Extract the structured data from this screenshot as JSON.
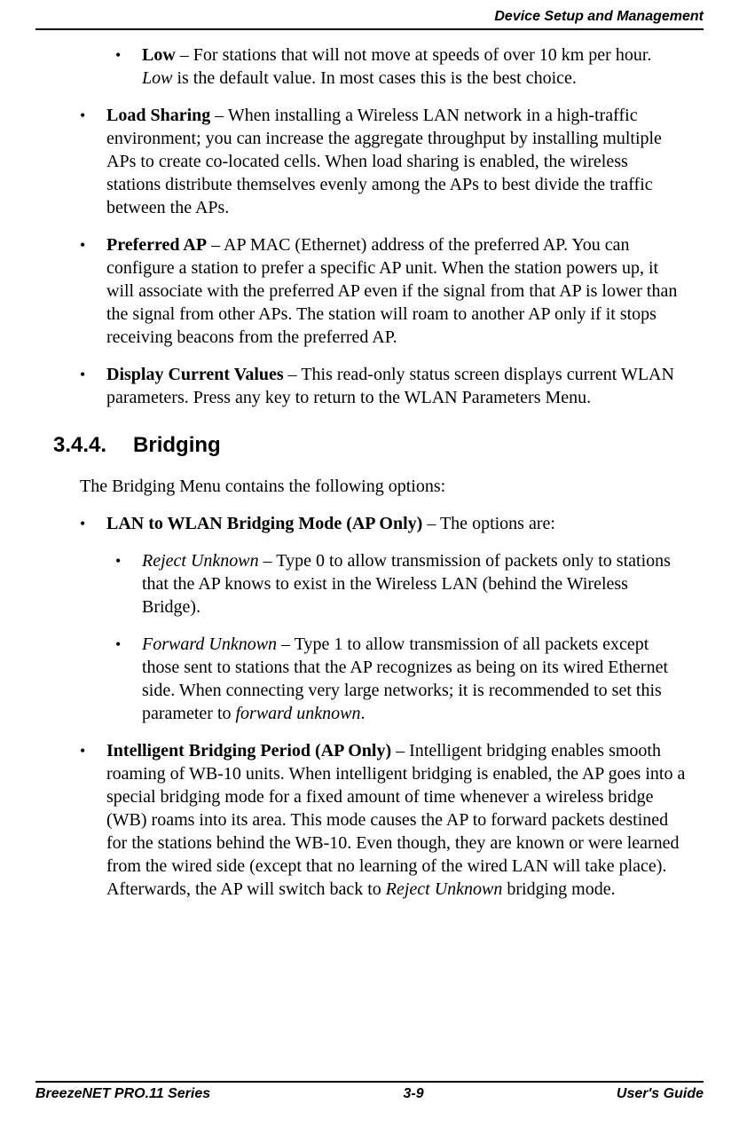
{
  "header": {
    "section_title": "Device Setup and Management"
  },
  "content": {
    "low": {
      "term": "Low",
      "sep": "  – ",
      "text1": "For stations that will not move at speeds of over 10 km per hour. ",
      "italic": "Low",
      "text2": " is the default value. In most cases this is the best choice."
    },
    "load_sharing": {
      "term": "Load Sharing",
      "sep": " – ",
      "text": "When installing a Wireless LAN network in a high-traffic environment; you can increase the aggregate throughput by installing multiple APs to create co-located cells. When load sharing is enabled, the wireless stations distribute themselves evenly among the APs to best divide the traffic between the APs."
    },
    "preferred_ap": {
      "term": "Preferred AP",
      "sep": " – ",
      "text": "AP MAC (Ethernet) address of the preferred AP. You can configure a station to prefer a specific AP unit. When the station powers up, it will associate with the preferred AP even if the signal from that AP is lower than the signal from other APs. The station will roam to another AP only if it stops receiving beacons from the preferred AP."
    },
    "display_current": {
      "term": "Display Current Values",
      "sep": " – ",
      "text": "This read-only status screen displays current WLAN parameters. Press any key to return to the WLAN Parameters Menu."
    },
    "heading": {
      "number": "3.4.4.",
      "title": "Bridging"
    },
    "intro": "The Bridging Menu contains the following options:",
    "lan_wlan": {
      "term": "LAN to WLAN Bridging Mode (AP Only)",
      "sep": " – ",
      "text": "The options are:"
    },
    "reject_unknown": {
      "term": "Reject Unknown",
      "sep": " – ",
      "text": "Type 0 to allow transmission of packets only to stations that the AP knows to exist in the Wireless LAN (behind the Wireless Bridge)."
    },
    "forward_unknown": {
      "term": "Forward Unknown",
      "sep": " – ",
      "text1": "Type 1 to allow transmission of all packets except those sent to stations that the AP recognizes as being on its wired Ethernet side. When connecting very large networks; it is recommended to set this parameter to ",
      "italic": "forward unknown",
      "text2": "."
    },
    "intelligent_bridging": {
      "term": "Intelligent Bridging Period (AP Only)",
      "sep": " – ",
      "text1": "Intelligent bridging enables smooth roaming of WB-10 units. When intelligent bridging is enabled, the AP goes into a special bridging mode for a fixed amount of time whenever a wireless bridge (WB) roams into its area. This mode causes the AP to forward packets destined for the stations behind the WB-10. Even though, they are known or were learned from the wired side (except that no learning of the wired LAN will take place). Afterwards, the AP will switch back to ",
      "italic": "Reject Unknown",
      "text2": " bridging mode."
    }
  },
  "footer": {
    "left": "BreezeNET PRO.11 Series",
    "center": "3-9",
    "right": "User's Guide"
  }
}
